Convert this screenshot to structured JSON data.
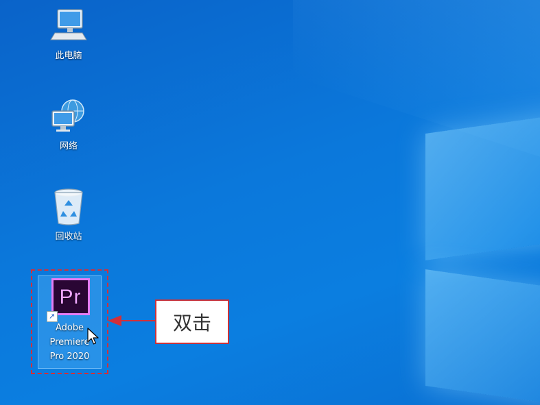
{
  "desktop": {
    "icons": [
      {
        "label": "此电脑",
        "icon": "computer-icon"
      },
      {
        "label": "网络",
        "icon": "network-icon"
      },
      {
        "label": "回收站",
        "icon": "recycle-bin-icon"
      }
    ],
    "premiere": {
      "icon_text": "Pr",
      "label_line1": "Adobe",
      "label_line2": "Premiere",
      "label_line3": "Pro 2020",
      "shortcut_glyph": "↗"
    }
  },
  "annotation": {
    "callout_text": "双击",
    "accent_color": "#d1303a"
  }
}
